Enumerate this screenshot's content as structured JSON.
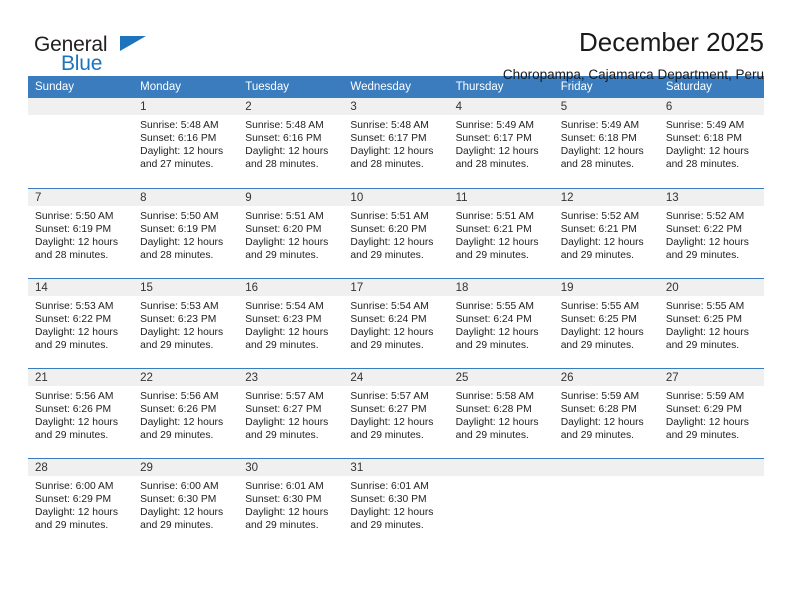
{
  "brand": {
    "name_part1": "General",
    "name_part2": "Blue",
    "accent_color": "#1d74bd"
  },
  "header": {
    "title": "December 2025",
    "subtitle": "Choropampa, Cajamarca Department, Peru"
  },
  "calendar": {
    "header_bg": "#3a7cbe",
    "daynum_bg": "#f0f0f0",
    "weekday_headers": [
      "Sunday",
      "Monday",
      "Tuesday",
      "Wednesday",
      "Thursday",
      "Friday",
      "Saturday"
    ],
    "weeks": [
      [
        {
          "day": "",
          "lines": []
        },
        {
          "day": "1",
          "lines": [
            "Sunrise: 5:48 AM",
            "Sunset: 6:16 PM",
            "Daylight: 12 hours",
            "and 27 minutes."
          ]
        },
        {
          "day": "2",
          "lines": [
            "Sunrise: 5:48 AM",
            "Sunset: 6:16 PM",
            "Daylight: 12 hours",
            "and 28 minutes."
          ]
        },
        {
          "day": "3",
          "lines": [
            "Sunrise: 5:48 AM",
            "Sunset: 6:17 PM",
            "Daylight: 12 hours",
            "and 28 minutes."
          ]
        },
        {
          "day": "4",
          "lines": [
            "Sunrise: 5:49 AM",
            "Sunset: 6:17 PM",
            "Daylight: 12 hours",
            "and 28 minutes."
          ]
        },
        {
          "day": "5",
          "lines": [
            "Sunrise: 5:49 AM",
            "Sunset: 6:18 PM",
            "Daylight: 12 hours",
            "and 28 minutes."
          ]
        },
        {
          "day": "6",
          "lines": [
            "Sunrise: 5:49 AM",
            "Sunset: 6:18 PM",
            "Daylight: 12 hours",
            "and 28 minutes."
          ]
        }
      ],
      [
        {
          "day": "7",
          "lines": [
            "Sunrise: 5:50 AM",
            "Sunset: 6:19 PM",
            "Daylight: 12 hours",
            "and 28 minutes."
          ]
        },
        {
          "day": "8",
          "lines": [
            "Sunrise: 5:50 AM",
            "Sunset: 6:19 PM",
            "Daylight: 12 hours",
            "and 28 minutes."
          ]
        },
        {
          "day": "9",
          "lines": [
            "Sunrise: 5:51 AM",
            "Sunset: 6:20 PM",
            "Daylight: 12 hours",
            "and 29 minutes."
          ]
        },
        {
          "day": "10",
          "lines": [
            "Sunrise: 5:51 AM",
            "Sunset: 6:20 PM",
            "Daylight: 12 hours",
            "and 29 minutes."
          ]
        },
        {
          "day": "11",
          "lines": [
            "Sunrise: 5:51 AM",
            "Sunset: 6:21 PM",
            "Daylight: 12 hours",
            "and 29 minutes."
          ]
        },
        {
          "day": "12",
          "lines": [
            "Sunrise: 5:52 AM",
            "Sunset: 6:21 PM",
            "Daylight: 12 hours",
            "and 29 minutes."
          ]
        },
        {
          "day": "13",
          "lines": [
            "Sunrise: 5:52 AM",
            "Sunset: 6:22 PM",
            "Daylight: 12 hours",
            "and 29 minutes."
          ]
        }
      ],
      [
        {
          "day": "14",
          "lines": [
            "Sunrise: 5:53 AM",
            "Sunset: 6:22 PM",
            "Daylight: 12 hours",
            "and 29 minutes."
          ]
        },
        {
          "day": "15",
          "lines": [
            "Sunrise: 5:53 AM",
            "Sunset: 6:23 PM",
            "Daylight: 12 hours",
            "and 29 minutes."
          ]
        },
        {
          "day": "16",
          "lines": [
            "Sunrise: 5:54 AM",
            "Sunset: 6:23 PM",
            "Daylight: 12 hours",
            "and 29 minutes."
          ]
        },
        {
          "day": "17",
          "lines": [
            "Sunrise: 5:54 AM",
            "Sunset: 6:24 PM",
            "Daylight: 12 hours",
            "and 29 minutes."
          ]
        },
        {
          "day": "18",
          "lines": [
            "Sunrise: 5:55 AM",
            "Sunset: 6:24 PM",
            "Daylight: 12 hours",
            "and 29 minutes."
          ]
        },
        {
          "day": "19",
          "lines": [
            "Sunrise: 5:55 AM",
            "Sunset: 6:25 PM",
            "Daylight: 12 hours",
            "and 29 minutes."
          ]
        },
        {
          "day": "20",
          "lines": [
            "Sunrise: 5:55 AM",
            "Sunset: 6:25 PM",
            "Daylight: 12 hours",
            "and 29 minutes."
          ]
        }
      ],
      [
        {
          "day": "21",
          "lines": [
            "Sunrise: 5:56 AM",
            "Sunset: 6:26 PM",
            "Daylight: 12 hours",
            "and 29 minutes."
          ]
        },
        {
          "day": "22",
          "lines": [
            "Sunrise: 5:56 AM",
            "Sunset: 6:26 PM",
            "Daylight: 12 hours",
            "and 29 minutes."
          ]
        },
        {
          "day": "23",
          "lines": [
            "Sunrise: 5:57 AM",
            "Sunset: 6:27 PM",
            "Daylight: 12 hours",
            "and 29 minutes."
          ]
        },
        {
          "day": "24",
          "lines": [
            "Sunrise: 5:57 AM",
            "Sunset: 6:27 PM",
            "Daylight: 12 hours",
            "and 29 minutes."
          ]
        },
        {
          "day": "25",
          "lines": [
            "Sunrise: 5:58 AM",
            "Sunset: 6:28 PM",
            "Daylight: 12 hours",
            "and 29 minutes."
          ]
        },
        {
          "day": "26",
          "lines": [
            "Sunrise: 5:59 AM",
            "Sunset: 6:28 PM",
            "Daylight: 12 hours",
            "and 29 minutes."
          ]
        },
        {
          "day": "27",
          "lines": [
            "Sunrise: 5:59 AM",
            "Sunset: 6:29 PM",
            "Daylight: 12 hours",
            "and 29 minutes."
          ]
        }
      ],
      [
        {
          "day": "28",
          "lines": [
            "Sunrise: 6:00 AM",
            "Sunset: 6:29 PM",
            "Daylight: 12 hours",
            "and 29 minutes."
          ]
        },
        {
          "day": "29",
          "lines": [
            "Sunrise: 6:00 AM",
            "Sunset: 6:30 PM",
            "Daylight: 12 hours",
            "and 29 minutes."
          ]
        },
        {
          "day": "30",
          "lines": [
            "Sunrise: 6:01 AM",
            "Sunset: 6:30 PM",
            "Daylight: 12 hours",
            "and 29 minutes."
          ]
        },
        {
          "day": "31",
          "lines": [
            "Sunrise: 6:01 AM",
            "Sunset: 6:30 PM",
            "Daylight: 12 hours",
            "and 29 minutes."
          ]
        },
        {
          "day": "",
          "lines": []
        },
        {
          "day": "",
          "lines": []
        },
        {
          "day": "",
          "lines": []
        }
      ]
    ]
  }
}
